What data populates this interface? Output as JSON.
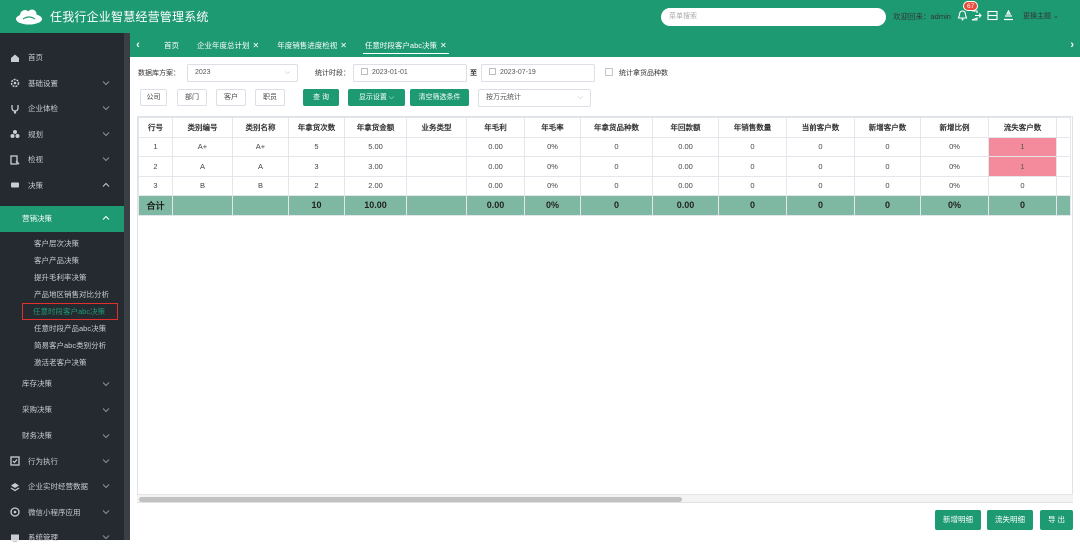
{
  "header": {
    "title": "任我行企业智慧经营管理系统",
    "search_placeholder": "菜单搜索",
    "welcome": "欢迎回来：admin",
    "notification_count": "67",
    "theme_label": "更换主题"
  },
  "sidebar": {
    "items": [
      {
        "label": "首页",
        "icon": "home-icon"
      },
      {
        "label": "基础设置",
        "icon": "gear-icon"
      },
      {
        "label": "企业体检",
        "icon": "stethoscope-icon"
      },
      {
        "label": "规划",
        "icon": "cluster-icon"
      },
      {
        "label": "检视",
        "icon": "review-icon"
      },
      {
        "label": "决策",
        "icon": "decision-icon"
      }
    ],
    "active_group": "营销决策",
    "sub_items": [
      "客户层次决策",
      "客户产品决策",
      "提升毛利率决策",
      "产品地区销售对比分析",
      "任意时段客户abc决策",
      "任意时段产品abc决策",
      "简易客户abc类别分析",
      "激活老客户决策"
    ],
    "other_groups": [
      "库存决策",
      "采购决策",
      "财务决策"
    ],
    "bottom_items": [
      {
        "label": "行为执行",
        "icon": "execute-icon"
      },
      {
        "label": "企业实时经营数据",
        "icon": "layers-icon"
      },
      {
        "label": "微信小程序应用",
        "icon": "wechat-icon"
      },
      {
        "label": "系统管理",
        "icon": "system-icon"
      }
    ]
  },
  "tabs": [
    {
      "label": "首页",
      "closable": false
    },
    {
      "label": "企业年度总计划",
      "closable": true
    },
    {
      "label": "年度销售进度检视",
      "closable": true
    },
    {
      "label": "任意时段客户abc决策",
      "closable": true,
      "active": true
    }
  ],
  "filters": {
    "db_label": "数据库方案：",
    "db_value": "2023",
    "period_label": "统计时段：",
    "date_from": "2023-01-01",
    "to_label": "至",
    "date_to": "2023-07-19",
    "count_kinds_label": "统计拿货品种数",
    "dimension_buttons": [
      "公司",
      "部门",
      "客户",
      "职员"
    ],
    "query_button": "查 询",
    "display_settings": "显示设置",
    "clear_filters": "清空筛选条件",
    "stat_mode": "按万元统计"
  },
  "table": {
    "columns": [
      "行号",
      "类别编号",
      "类别名称",
      "年拿货次数",
      "年拿货金额",
      "业务类型",
      "年毛利",
      "年毛率",
      "年拿货品种数",
      "年回款额",
      "年销售数量",
      "当前客户数",
      "新增客户数",
      "新增比例",
      "流失客户数"
    ],
    "rows": [
      [
        "1",
        "A+",
        "A+",
        "5",
        "5.00",
        "",
        "0.00",
        "0%",
        "0",
        "0.00",
        "0",
        "0",
        "0",
        "0%",
        "1"
      ],
      [
        "2",
        "A",
        "A",
        "3",
        "3.00",
        "",
        "0.00",
        "0%",
        "0",
        "0.00",
        "0",
        "0",
        "0",
        "0%",
        "1"
      ],
      [
        "3",
        "B",
        "B",
        "2",
        "2.00",
        "",
        "0.00",
        "0%",
        "0",
        "0.00",
        "0",
        "0",
        "0",
        "0%",
        "0"
      ]
    ],
    "total": [
      "合计",
      "",
      "",
      "10",
      "10.00",
      "",
      "0.00",
      "0%",
      "0",
      "0.00",
      "0",
      "0",
      "0",
      "0%",
      "0"
    ],
    "highlight_color": "#f38b9c",
    "total_color": "#7eb8a3"
  },
  "actions": {
    "new_detail": "新增明细",
    "lost_detail": "流失明细",
    "export": "导 出"
  },
  "colors": {
    "brand": "#1e9a72",
    "sidebar_bg": "#252a30",
    "alert": "#e0312c"
  }
}
